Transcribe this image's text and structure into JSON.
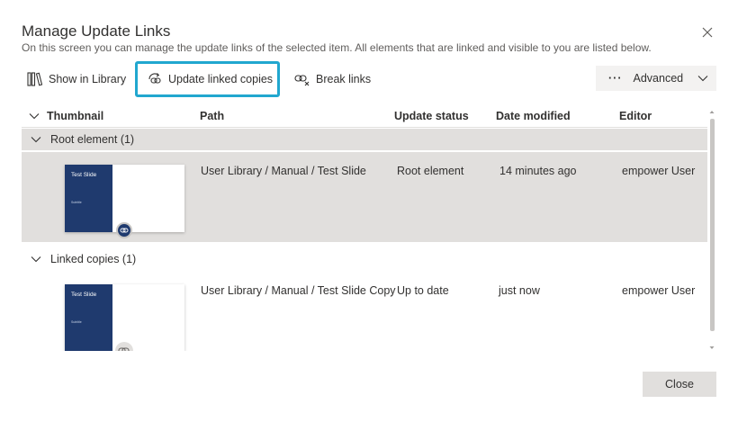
{
  "dialog": {
    "title": "Manage Update Links",
    "subtitle": "On this screen you can manage the update links of the selected item. All elements that are linked and visible to you are listed below."
  },
  "toolbar": {
    "show_in_library": "Show in Library",
    "update_linked_copies": "Update linked copies",
    "break_links": "Break links",
    "advanced_dots": "···",
    "advanced": "Advanced"
  },
  "table": {
    "columns": [
      "Thumbnail",
      "Path",
      "Update status",
      "Date modified",
      "Editor"
    ],
    "groups": [
      {
        "label": "Root element (1)",
        "rows": [
          {
            "thumb_title": "Test Slide",
            "thumb_subtitle": "Subtitle",
            "path": "User Library / Manual / Test Slide",
            "status": "Root element",
            "date": "14 minutes ago",
            "editor": "empower User"
          }
        ]
      },
      {
        "label": "Linked copies (1)",
        "rows": [
          {
            "thumb_title": "Test Slide",
            "thumb_subtitle": "Subtitle",
            "path": "User Library / Manual / Test Slide Copy",
            "status": "Up to date",
            "date": "just now",
            "editor": "empower User"
          }
        ]
      }
    ]
  },
  "footer": {
    "close": "Close"
  },
  "colors": {
    "highlight": "#21a7cf",
    "selected_row": "#e1dfdd",
    "group_row": "#edebe9",
    "slide_navy": "#1f3a6e"
  }
}
